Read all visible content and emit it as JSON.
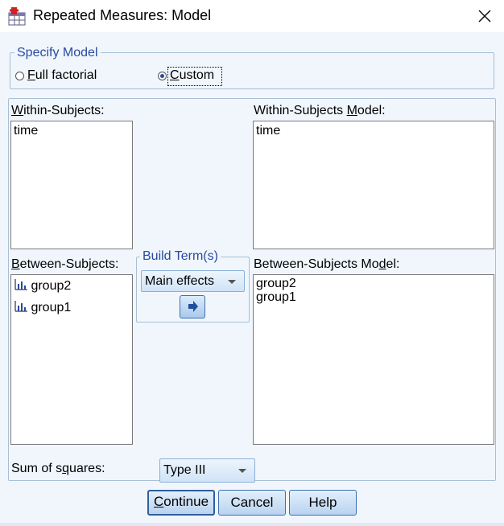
{
  "window": {
    "title": "Repeated Measures: Model"
  },
  "specify_model": {
    "legend": "Specify Model",
    "full_factorial": {
      "mnemonic": "F",
      "rest": "ull factorial",
      "selected": false
    },
    "custom": {
      "mnemonic": "C",
      "rest": "ustom",
      "selected": true
    }
  },
  "within_subjects": {
    "label_mnemonic": "W",
    "label_rest": "ithin-Subjects:",
    "items": [
      "time"
    ]
  },
  "within_subjects_model": {
    "label_pre": "Within-Subjects ",
    "label_mnemonic": "M",
    "label_post": "odel:",
    "items": [
      "time"
    ]
  },
  "between_subjects": {
    "label_mnemonic": "B",
    "label_rest": "etween-Subjects:",
    "items": [
      "group2",
      "group1"
    ],
    "item_icon": "scale-icon"
  },
  "between_subjects_model": {
    "label_pre": "Between-Subjects Mo",
    "label_mnemonic": "d",
    "label_post": "el:",
    "items": [
      "group2",
      "group1"
    ]
  },
  "build_terms": {
    "legend": "Build Term(s)",
    "selected": "Main effects",
    "arrow_icon": "arrow-right-icon"
  },
  "sum_of_squares": {
    "label_pre": "Sum of s",
    "label_mnemonic": "q",
    "label_post": "uares:",
    "selected": "Type III"
  },
  "buttons": {
    "continue": {
      "mnemonic": "C",
      "rest": "ontinue"
    },
    "cancel": "Cancel",
    "help": "Help"
  },
  "colors": {
    "client_bg": "#f0f6fc",
    "legend_text": "#2a4aa0",
    "button_border": "#3d6fb0"
  }
}
